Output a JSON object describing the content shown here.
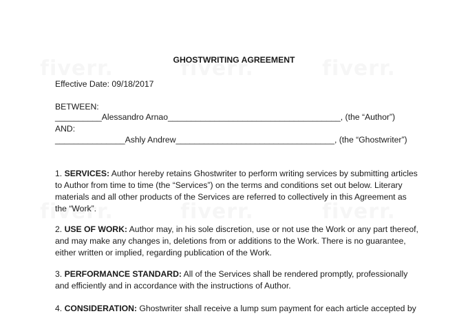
{
  "document": {
    "title": "GHOSTWRITING AGREEMENT",
    "effective_date": "Effective Date: 09/18/2017",
    "between_label": "BETWEEN:",
    "author_line": "__________Alessandro Arnao_____________________________________, (the “Author”)",
    "and_label": "AND:",
    "ghostwriter_line": "_______________Ashly Andrew__________________________________, (the “Ghostwriter”)",
    "sections": [
      {
        "number": "1. ",
        "heading": "SERVICES:",
        "text": "  Author hereby retains Ghostwriter to perform writing services by submitting articles to Author from time to time (the “Services”) on the terms and conditions set out below. Literary materials and all other products of the Services are referred to collectively in this Agreement as the “Work”."
      },
      {
        "number": "2. ",
        "heading": "USE OF WORK:",
        "text": "  Author may, in his sole discretion, use or not use the Work or any part thereof, and may make any changes in, deletions from or additions to the Work. There is no guarantee, either written or implied, regarding publication of the Work."
      },
      {
        "number": "3. ",
        "heading": "PERFORMANCE STANDARD:",
        "text": "  All of the Services shall be rendered promptly, professionally and efficiently and in accordance with the instructions of Author."
      },
      {
        "number": "4. ",
        "heading": "CONSIDERATION:",
        "text": " Ghostwriter shall receive a lump sum payment for each article accepted by"
      }
    ]
  },
  "watermark": {
    "text": "fiverr."
  }
}
